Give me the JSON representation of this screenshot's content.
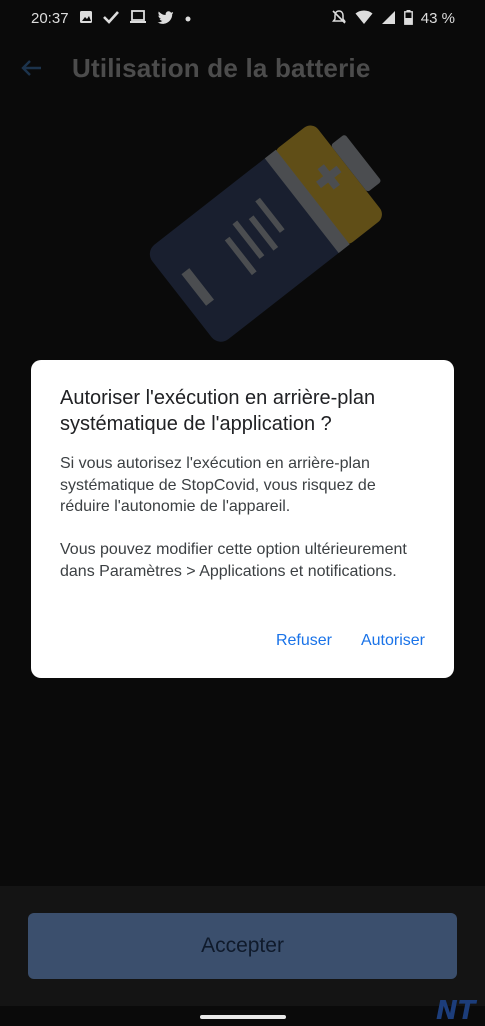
{
  "status_bar": {
    "time": "20:37",
    "left_icons": [
      "image-icon",
      "check-icon",
      "laptop-icon",
      "twitter-icon",
      "dot-icon"
    ],
    "right_icons": [
      "bell-off-icon",
      "wifi-icon",
      "signal-icon",
      "battery-icon"
    ],
    "battery_percent": "43 %"
  },
  "app_bar": {
    "back_icon": "arrow-left-icon",
    "title": "Utilisation de la batterie"
  },
  "illustration": {
    "name": "battery-illustration",
    "colors": {
      "body": "#2d3a5c",
      "cap": "#c9a227",
      "stripe": "#9aa0a6"
    }
  },
  "dialog": {
    "title": "Autoriser l'exécution en arrière-plan systématique de l'application ?",
    "body": "Si vous autorisez l'exécution en arrière-plan systématique de StopCovid, vous risquez de réduire l'autonomie de l'appareil.\n\nVous pouvez modifier cette option ultérieurement dans Paramètres > Applications et notifications.",
    "deny_label": "Refuser",
    "allow_label": "Autoriser"
  },
  "footer": {
    "accept_label": "Accepter"
  },
  "watermark": "NT",
  "colors": {
    "accent": "#1a73e8",
    "button_bg": "#3b4f6d",
    "background": "#0a0a0a"
  }
}
